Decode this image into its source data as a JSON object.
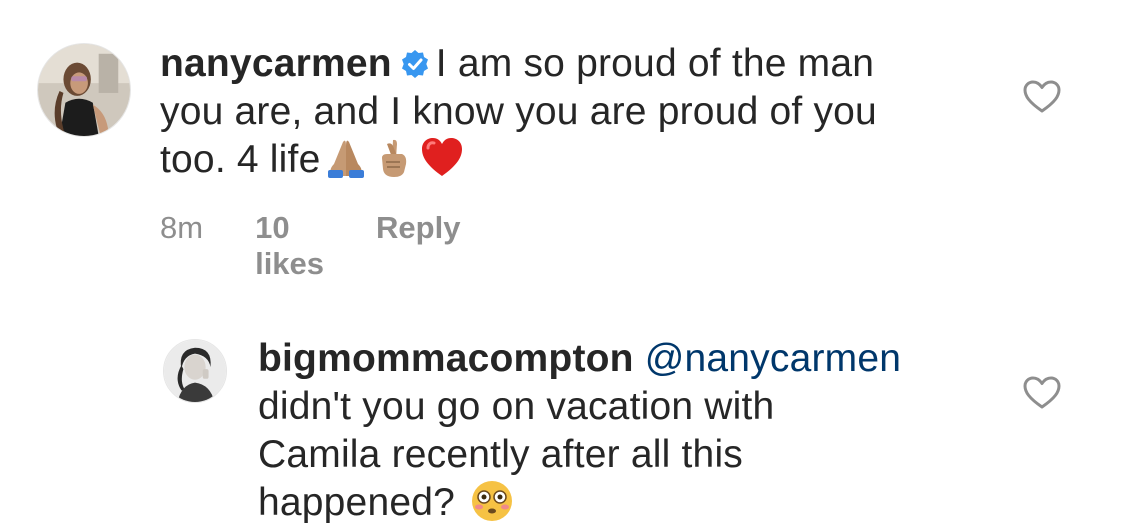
{
  "comments": [
    {
      "username": "nanycarmen",
      "verified": true,
      "text_line1": "I am so proud of the man",
      "text_line2": "you are, and I know you are proud of you",
      "text_line3": "too. 4 life",
      "emojis": [
        "folded-hands-emoji",
        "crossed-fingers-emoji",
        "red-heart-emoji"
      ],
      "time": "8m",
      "likes": "10 likes",
      "reply_label": "Reply"
    },
    {
      "username": "bigmommacompton",
      "mention": "@nanycarmen",
      "text_line1": "didn't you go on vacation with",
      "text_line2": "Camila recently after all this",
      "text_line3": "happened?",
      "emojis": [
        "flushed-face-emoji"
      ]
    }
  ],
  "colors": {
    "text": "#262626",
    "meta": "#8e8e8e",
    "mention": "#00376b",
    "verified_badge": "#3897f0",
    "heart_outline": "#8e8e8e"
  }
}
